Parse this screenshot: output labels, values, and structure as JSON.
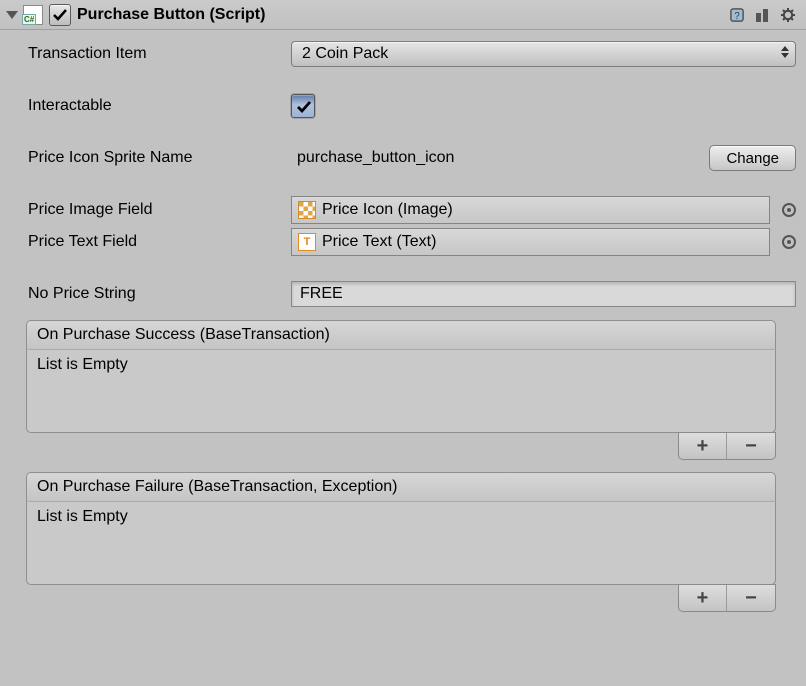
{
  "component": {
    "title": "Purchase Button (Script)",
    "enabled": true
  },
  "fields": {
    "transaction_item": {
      "label": "Transaction Item",
      "value": "2 Coin Pack"
    },
    "interactable": {
      "label": "Interactable",
      "checked": true
    },
    "sprite_name": {
      "label": "Price Icon Sprite Name",
      "value": "purchase_button_icon",
      "change_btn": "Change"
    },
    "price_image": {
      "label": "Price Image Field",
      "value": "Price Icon (Image)",
      "icon": "image"
    },
    "price_text": {
      "label": "Price Text Field",
      "value": "Price Text (Text)",
      "icon": "text"
    },
    "no_price": {
      "label": "No Price String",
      "value": "FREE"
    }
  },
  "events": {
    "success": {
      "title": "On Purchase Success (BaseTransaction)",
      "empty_text": "List is Empty"
    },
    "failure": {
      "title": "On Purchase Failure (BaseTransaction, Exception)",
      "empty_text": "List is Empty"
    }
  },
  "glyphs": {
    "plus": "+",
    "minus": "−",
    "text_icon": "T"
  }
}
